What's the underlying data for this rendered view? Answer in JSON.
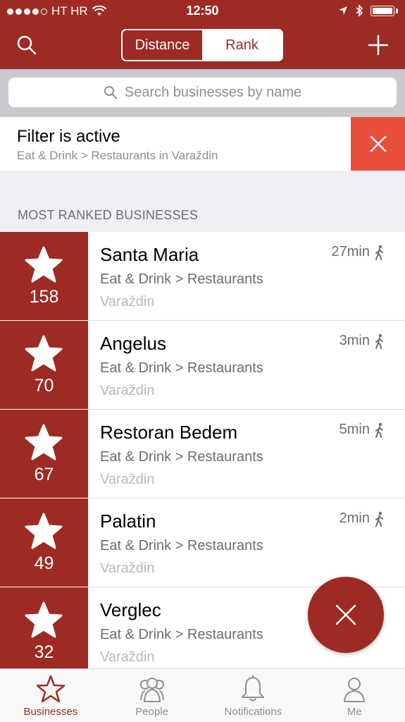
{
  "status": {
    "carrier": "HT HR",
    "time": "12:50"
  },
  "nav": {
    "segments": [
      "Distance",
      "Rank"
    ],
    "active_segment": "Rank"
  },
  "search": {
    "placeholder": "Search businesses by name"
  },
  "filter": {
    "title": "Filter is active",
    "subtitle": "Eat & Drink > Restaurants in Varaždin"
  },
  "section": {
    "title": "MOST RANKED BUSINESSES"
  },
  "businesses": [
    {
      "rank": "158",
      "name": "Santa Maria",
      "category": "Eat & Drink > Restaurants",
      "city": "Varaždin",
      "time": "27min"
    },
    {
      "rank": "70",
      "name": "Angelus",
      "category": "Eat & Drink > Restaurants",
      "city": "Varaždin",
      "time": "3min"
    },
    {
      "rank": "67",
      "name": "Restoran Bedem",
      "category": "Eat & Drink > Restaurants",
      "city": "Varaždin",
      "time": "5min"
    },
    {
      "rank": "49",
      "name": "Palatin",
      "category": "Eat & Drink > Restaurants",
      "city": "Varaždin",
      "time": "2min"
    },
    {
      "rank": "32",
      "name": "Verglec",
      "category": "Eat & Drink > Restaurants",
      "city": "Varaždin",
      "time": ""
    }
  ],
  "tabs": [
    {
      "label": "Businesses",
      "icon": "star-icon",
      "active": true
    },
    {
      "label": "People",
      "icon": "people-icon",
      "active": false
    },
    {
      "label": "Notifications",
      "icon": "bell-icon",
      "active": false
    },
    {
      "label": "Me",
      "icon": "person-icon",
      "active": false
    }
  ],
  "colors": {
    "brand": "#9e2a24",
    "close_accent": "#e8503a"
  }
}
